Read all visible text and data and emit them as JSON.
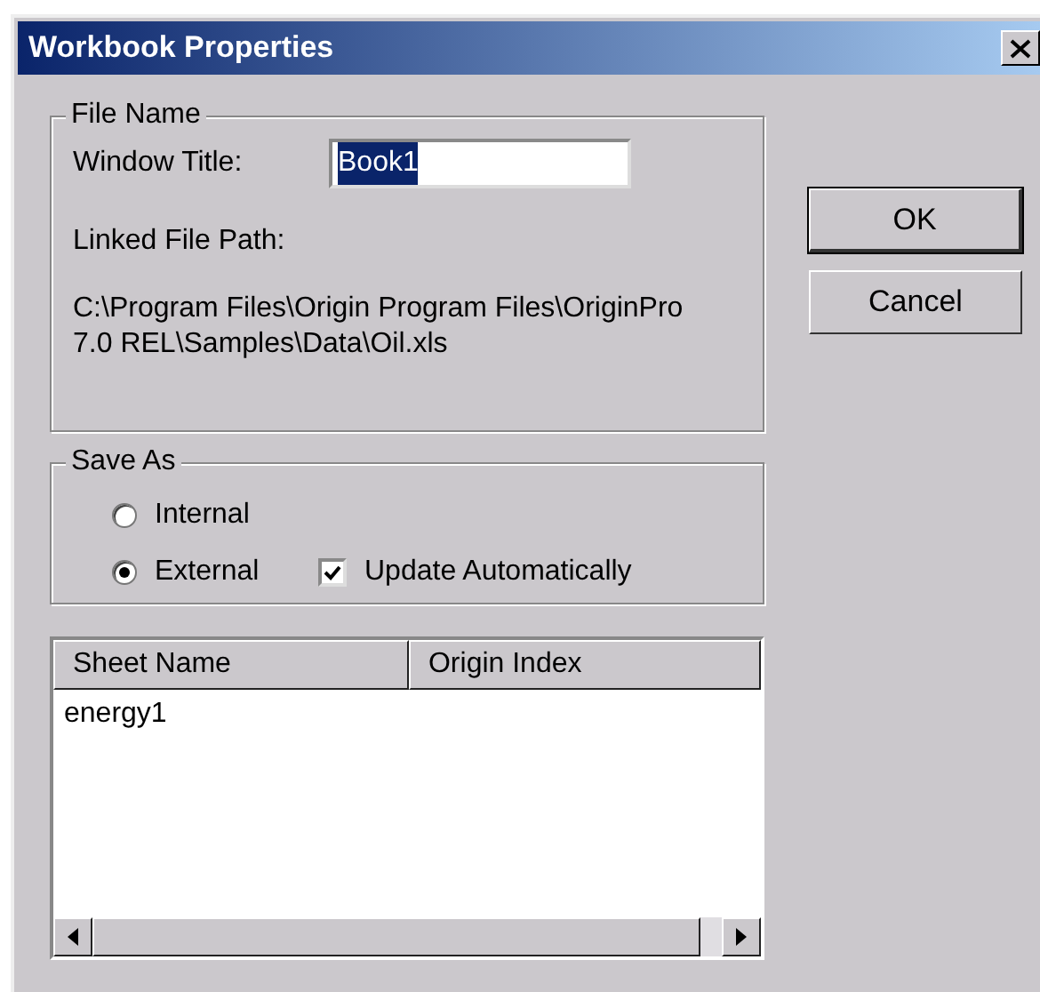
{
  "window": {
    "title": "Workbook Properties"
  },
  "file_name": {
    "legend": "File Name",
    "window_title_label": "Window Title:",
    "window_title_value": "Book1",
    "value_selected": true,
    "linked_path_label": "Linked File Path:",
    "linked_path_lines": [
      "C:\\Program Files\\Origin Program Files\\OriginPro",
      "7.0 REL\\Samples\\Data\\Oil.xls"
    ]
  },
  "save_as": {
    "legend": "Save As",
    "options": [
      {
        "label": "Internal",
        "selected": false
      },
      {
        "label": "External",
        "selected": true
      }
    ],
    "update_automatically": {
      "label": "Update Automatically",
      "checked": true
    }
  },
  "sheets": {
    "columns": [
      "Sheet Name",
      "Origin Index"
    ],
    "rows": [
      [
        "energy1"
      ]
    ]
  },
  "buttons": [
    {
      "label": "OK",
      "default": true
    },
    {
      "label": "Cancel",
      "default": false
    }
  ]
}
